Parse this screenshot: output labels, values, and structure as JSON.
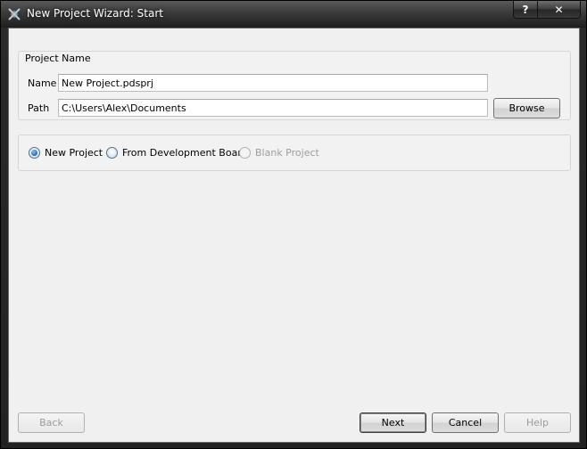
{
  "window": {
    "title": "New Project Wizard: Start",
    "help_label": "?",
    "close_label": "✕"
  },
  "project_name_group": {
    "title": "Project Name",
    "name_label": "Name",
    "name_value": "New Project.pdsprj",
    "path_label": "Path",
    "path_value": "C:\\Users\\Alex\\Documents",
    "browse_label": "Browse"
  },
  "project_type": {
    "options": [
      {
        "label": "New Project",
        "selected": true,
        "enabled": true
      },
      {
        "label": "From Development Board",
        "selected": false,
        "enabled": true
      },
      {
        "label": "Blank Project",
        "selected": false,
        "enabled": false
      }
    ]
  },
  "footer": {
    "back_label": "Back",
    "next_label": "Next",
    "cancel_label": "Cancel",
    "help_label": "Help"
  }
}
